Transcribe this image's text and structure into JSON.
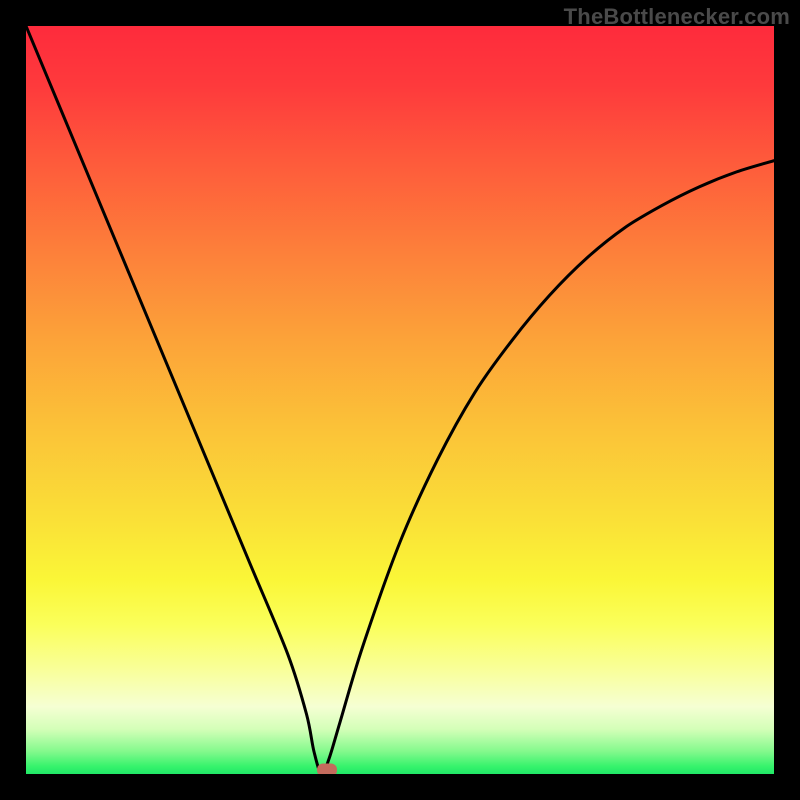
{
  "watermark": "TheBottlenecker.com",
  "colors": {
    "page_bg": "#000000",
    "curve": "#000000",
    "marker": "#c46b5d",
    "watermark": "#4a4a4a"
  },
  "chart_data": {
    "type": "line",
    "title": "",
    "xlabel": "",
    "ylabel": "",
    "xlim": [
      0,
      100
    ],
    "ylim": [
      0,
      100
    ],
    "series": [
      {
        "name": "bottleneck-curve",
        "x": [
          0,
          5,
          10,
          15,
          20,
          25,
          30,
          35,
          37.5,
          38.5,
          39.5,
          40.5,
          42,
          45,
          50,
          55,
          60,
          65,
          70,
          75,
          80,
          85,
          90,
          95,
          100
        ],
        "values": [
          100,
          88,
          76,
          64,
          52,
          40,
          28,
          16,
          8,
          3,
          0,
          2,
          7,
          17,
          31,
          42,
          51,
          58,
          64,
          69,
          73,
          76,
          78.5,
          80.5,
          82
        ]
      }
    ],
    "marker": {
      "x": 40.3,
      "y": 0.5
    },
    "gradient_stops": [
      {
        "pos": 0,
        "color": "#fe2b3c"
      },
      {
        "pos": 50,
        "color": "#fbc338"
      },
      {
        "pos": 78,
        "color": "#faff5a"
      },
      {
        "pos": 100,
        "color": "#20e867"
      }
    ]
  }
}
